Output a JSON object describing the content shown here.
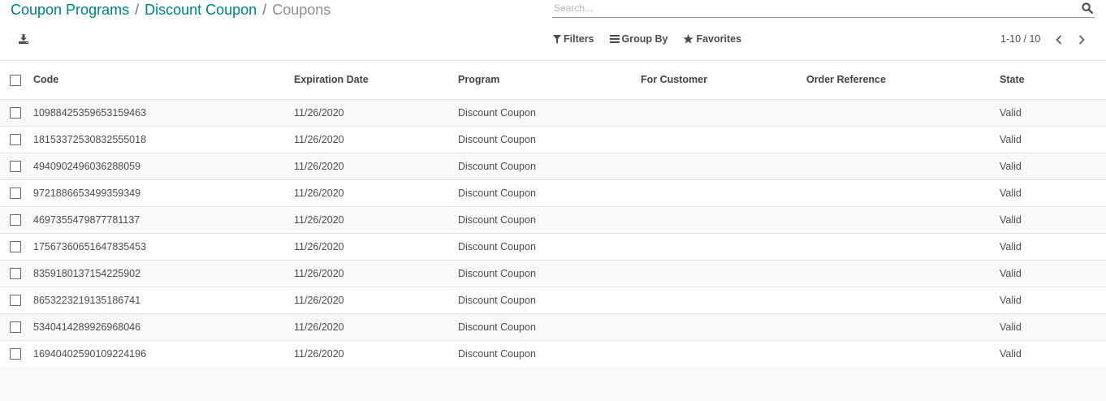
{
  "breadcrumb": {
    "items": [
      "Coupon Programs",
      "Discount Coupon"
    ],
    "separator": "/",
    "current": "Coupons"
  },
  "search": {
    "placeholder": "Search..."
  },
  "toolbar": {
    "filters_label": "Filters",
    "group_by_label": "Group By",
    "favorites_label": "Favorites"
  },
  "pager": {
    "value": "1-10 / 10"
  },
  "table": {
    "columns": [
      "Code",
      "Expiration Date",
      "Program",
      "For Customer",
      "Order Reference",
      "State"
    ],
    "rows": [
      {
        "code": "10988425359653159463",
        "expiration": "11/26/2020",
        "program": "Discount Coupon",
        "customer": "",
        "order": "",
        "state": "Valid"
      },
      {
        "code": "18153372530832555018",
        "expiration": "11/26/2020",
        "program": "Discount Coupon",
        "customer": "",
        "order": "",
        "state": "Valid"
      },
      {
        "code": "4940902496036288059",
        "expiration": "11/26/2020",
        "program": "Discount Coupon",
        "customer": "",
        "order": "",
        "state": "Valid"
      },
      {
        "code": "9721886653499359349",
        "expiration": "11/26/2020",
        "program": "Discount Coupon",
        "customer": "",
        "order": "",
        "state": "Valid"
      },
      {
        "code": "4697355479877781137",
        "expiration": "11/26/2020",
        "program": "Discount Coupon",
        "customer": "",
        "order": "",
        "state": "Valid"
      },
      {
        "code": "17567360651647835453",
        "expiration": "11/26/2020",
        "program": "Discount Coupon",
        "customer": "",
        "order": "",
        "state": "Valid"
      },
      {
        "code": "8359180137154225902",
        "expiration": "11/26/2020",
        "program": "Discount Coupon",
        "customer": "",
        "order": "",
        "state": "Valid"
      },
      {
        "code": "8653223219135186741",
        "expiration": "11/26/2020",
        "program": "Discount Coupon",
        "customer": "",
        "order": "",
        "state": "Valid"
      },
      {
        "code": "5340414289926968046",
        "expiration": "11/26/2020",
        "program": "Discount Coupon",
        "customer": "",
        "order": "",
        "state": "Valid"
      },
      {
        "code": "16940402590109224196",
        "expiration": "11/26/2020",
        "program": "Discount Coupon",
        "customer": "",
        "order": "",
        "state": "Valid"
      }
    ]
  },
  "icons": {
    "search": "search-icon",
    "download": "download-icon",
    "filter": "filter-icon",
    "group_by": "bars-icon",
    "favorites": "star-icon",
    "prev": "chevron-left-icon",
    "next": "chevron-right-icon"
  },
  "colors": {
    "link": "#017e84",
    "text": "#4c4c4c",
    "muted": "#8f8f8f",
    "row_alt": "#f9f9f9"
  }
}
